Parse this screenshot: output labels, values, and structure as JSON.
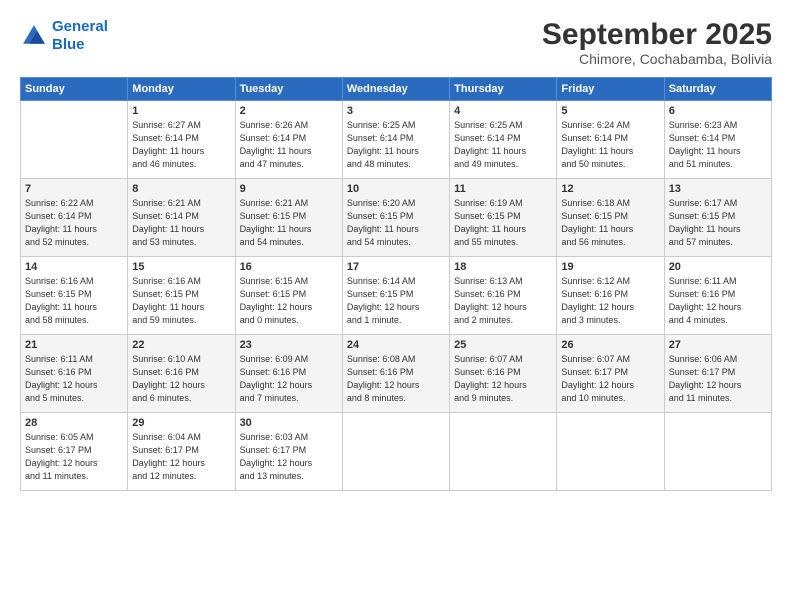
{
  "logo": {
    "line1": "General",
    "line2": "Blue"
  },
  "title": "September 2025",
  "subtitle": "Chimore, Cochabamba, Bolivia",
  "days_of_week": [
    "Sunday",
    "Monday",
    "Tuesday",
    "Wednesday",
    "Thursday",
    "Friday",
    "Saturday"
  ],
  "weeks": [
    [
      {
        "day": "",
        "info": ""
      },
      {
        "day": "1",
        "info": "Sunrise: 6:27 AM\nSunset: 6:14 PM\nDaylight: 11 hours\nand 46 minutes."
      },
      {
        "day": "2",
        "info": "Sunrise: 6:26 AM\nSunset: 6:14 PM\nDaylight: 11 hours\nand 47 minutes."
      },
      {
        "day": "3",
        "info": "Sunrise: 6:25 AM\nSunset: 6:14 PM\nDaylight: 11 hours\nand 48 minutes."
      },
      {
        "day": "4",
        "info": "Sunrise: 6:25 AM\nSunset: 6:14 PM\nDaylight: 11 hours\nand 49 minutes."
      },
      {
        "day": "5",
        "info": "Sunrise: 6:24 AM\nSunset: 6:14 PM\nDaylight: 11 hours\nand 50 minutes."
      },
      {
        "day": "6",
        "info": "Sunrise: 6:23 AM\nSunset: 6:14 PM\nDaylight: 11 hours\nand 51 minutes."
      }
    ],
    [
      {
        "day": "7",
        "info": "Sunrise: 6:22 AM\nSunset: 6:14 PM\nDaylight: 11 hours\nand 52 minutes."
      },
      {
        "day": "8",
        "info": "Sunrise: 6:21 AM\nSunset: 6:14 PM\nDaylight: 11 hours\nand 53 minutes."
      },
      {
        "day": "9",
        "info": "Sunrise: 6:21 AM\nSunset: 6:15 PM\nDaylight: 11 hours\nand 54 minutes."
      },
      {
        "day": "10",
        "info": "Sunrise: 6:20 AM\nSunset: 6:15 PM\nDaylight: 11 hours\nand 54 minutes."
      },
      {
        "day": "11",
        "info": "Sunrise: 6:19 AM\nSunset: 6:15 PM\nDaylight: 11 hours\nand 55 minutes."
      },
      {
        "day": "12",
        "info": "Sunrise: 6:18 AM\nSunset: 6:15 PM\nDaylight: 11 hours\nand 56 minutes."
      },
      {
        "day": "13",
        "info": "Sunrise: 6:17 AM\nSunset: 6:15 PM\nDaylight: 11 hours\nand 57 minutes."
      }
    ],
    [
      {
        "day": "14",
        "info": "Sunrise: 6:16 AM\nSunset: 6:15 PM\nDaylight: 11 hours\nand 58 minutes."
      },
      {
        "day": "15",
        "info": "Sunrise: 6:16 AM\nSunset: 6:15 PM\nDaylight: 11 hours\nand 59 minutes."
      },
      {
        "day": "16",
        "info": "Sunrise: 6:15 AM\nSunset: 6:15 PM\nDaylight: 12 hours\nand 0 minutes."
      },
      {
        "day": "17",
        "info": "Sunrise: 6:14 AM\nSunset: 6:15 PM\nDaylight: 12 hours\nand 1 minute."
      },
      {
        "day": "18",
        "info": "Sunrise: 6:13 AM\nSunset: 6:16 PM\nDaylight: 12 hours\nand 2 minutes."
      },
      {
        "day": "19",
        "info": "Sunrise: 6:12 AM\nSunset: 6:16 PM\nDaylight: 12 hours\nand 3 minutes."
      },
      {
        "day": "20",
        "info": "Sunrise: 6:11 AM\nSunset: 6:16 PM\nDaylight: 12 hours\nand 4 minutes."
      }
    ],
    [
      {
        "day": "21",
        "info": "Sunrise: 6:11 AM\nSunset: 6:16 PM\nDaylight: 12 hours\nand 5 minutes."
      },
      {
        "day": "22",
        "info": "Sunrise: 6:10 AM\nSunset: 6:16 PM\nDaylight: 12 hours\nand 6 minutes."
      },
      {
        "day": "23",
        "info": "Sunrise: 6:09 AM\nSunset: 6:16 PM\nDaylight: 12 hours\nand 7 minutes."
      },
      {
        "day": "24",
        "info": "Sunrise: 6:08 AM\nSunset: 6:16 PM\nDaylight: 12 hours\nand 8 minutes."
      },
      {
        "day": "25",
        "info": "Sunrise: 6:07 AM\nSunset: 6:16 PM\nDaylight: 12 hours\nand 9 minutes."
      },
      {
        "day": "26",
        "info": "Sunrise: 6:07 AM\nSunset: 6:17 PM\nDaylight: 12 hours\nand 10 minutes."
      },
      {
        "day": "27",
        "info": "Sunrise: 6:06 AM\nSunset: 6:17 PM\nDaylight: 12 hours\nand 11 minutes."
      }
    ],
    [
      {
        "day": "28",
        "info": "Sunrise: 6:05 AM\nSunset: 6:17 PM\nDaylight: 12 hours\nand 11 minutes."
      },
      {
        "day": "29",
        "info": "Sunrise: 6:04 AM\nSunset: 6:17 PM\nDaylight: 12 hours\nand 12 minutes."
      },
      {
        "day": "30",
        "info": "Sunrise: 6:03 AM\nSunset: 6:17 PM\nDaylight: 12 hours\nand 13 minutes."
      },
      {
        "day": "",
        "info": ""
      },
      {
        "day": "",
        "info": ""
      },
      {
        "day": "",
        "info": ""
      },
      {
        "day": "",
        "info": ""
      }
    ]
  ]
}
